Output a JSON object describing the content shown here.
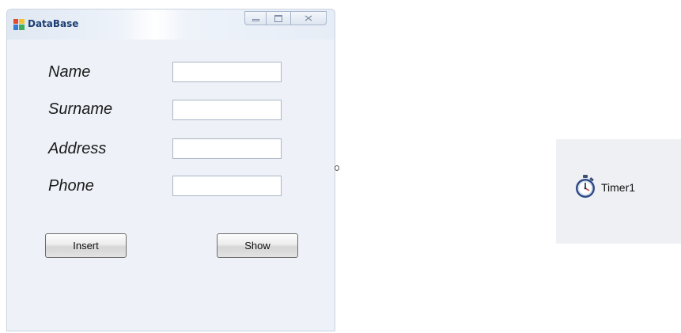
{
  "window": {
    "title": "DataBase",
    "caption_buttons": [
      "minimize",
      "maximize",
      "close"
    ]
  },
  "form": {
    "fields": [
      {
        "label": "Name",
        "value": ""
      },
      {
        "label": "Surname",
        "value": ""
      },
      {
        "label": "Address",
        "value": ""
      },
      {
        "label": "Phone",
        "value": ""
      }
    ],
    "buttons": {
      "insert_label": "Insert",
      "show_label": "Show"
    }
  },
  "tray": {
    "components": [
      {
        "name": "Timer1",
        "icon": "stopwatch-icon"
      }
    ]
  },
  "colors": {
    "title_text": "#1d3f73",
    "window_background": "#eef2f8",
    "tray_background": "#eef0f4"
  }
}
